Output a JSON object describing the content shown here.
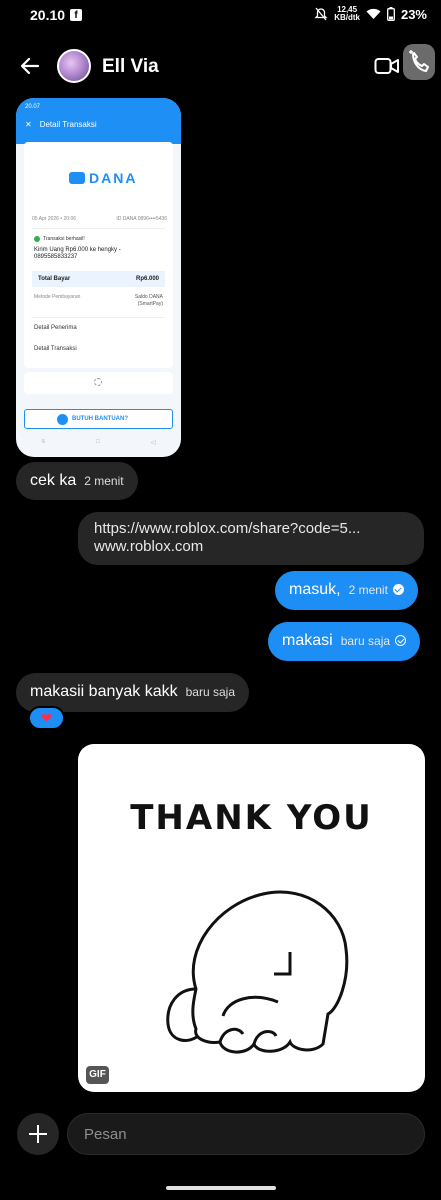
{
  "status_bar": {
    "time": "20.10",
    "speed_top": "12,45",
    "speed_bottom": "KB/dtk",
    "battery": "23%"
  },
  "header": {
    "contact_name": "Ell Via"
  },
  "screenshot_message": {
    "time": "20.07",
    "title": "Detail Transaksi",
    "brand": "DANA",
    "date": "05 Apr 2026 • 20:06",
    "id": "ID DANA 0896••••5436",
    "status": "Transaksi berhasil!",
    "description": "Kirim Uang Rp6.000 ke hengky - 0895585833237",
    "total_label": "Total Bayar",
    "total_value": "Rp6.000",
    "method_label": "Metode Pembayaran",
    "method_value": "Saldo DANA (SmartPay)",
    "recipient_label": "Detail Penerima",
    "transaction_label": "Detail Transaksi",
    "help_label": "BUTUH BANTUAN?"
  },
  "messages": [
    {
      "text": "cek ka",
      "time": "2 menit"
    },
    {
      "line1": "https://www.roblox.com/share?code=5...",
      "line2": "www.roblox.com"
    },
    {
      "text": "masuk,",
      "time": "2 menit"
    },
    {
      "text": "makasi",
      "time": "baru saja"
    },
    {
      "text": "makasii banyak kakk",
      "time": "baru saja"
    }
  ],
  "reaction": "❤",
  "gif": {
    "caption": "THANK YOU",
    "badge": "GIF"
  },
  "composer": {
    "placeholder": "Pesan"
  }
}
